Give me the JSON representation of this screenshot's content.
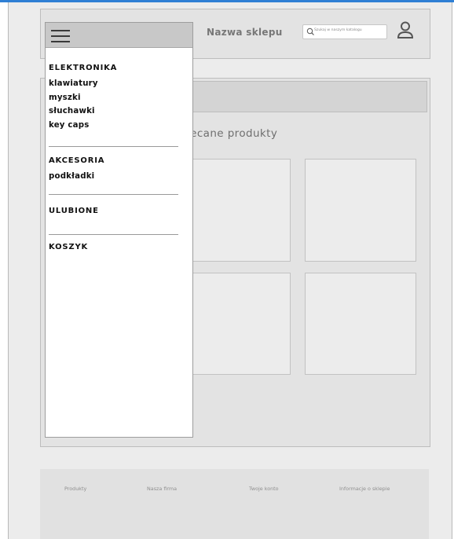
{
  "header": {
    "store_name": "Nazwa sklepu",
    "search_placeholder": "Szukaj w naszym katalogu",
    "search_icon": "search-icon",
    "user_icon": "user-icon"
  },
  "main": {
    "section_title": "lecane produkty",
    "products": [
      "",
      "",
      "",
      ""
    ]
  },
  "menu": {
    "hamburger_icon": "hamburger-icon",
    "categories": [
      {
        "label": "ELEKTRONIKA",
        "items": [
          "klawiatury",
          "myszki",
          "słuchawki",
          "key caps"
        ]
      },
      {
        "label": "AKCESORIA",
        "items": [
          "podkładki"
        ]
      },
      {
        "label": "ULUBIONE",
        "items": []
      },
      {
        "label": "KOSZYK",
        "items": []
      }
    ]
  },
  "footer": {
    "links": [
      "Produkty",
      "Nasza firma",
      "Twoje konto",
      "Informacje o sklepie"
    ]
  }
}
